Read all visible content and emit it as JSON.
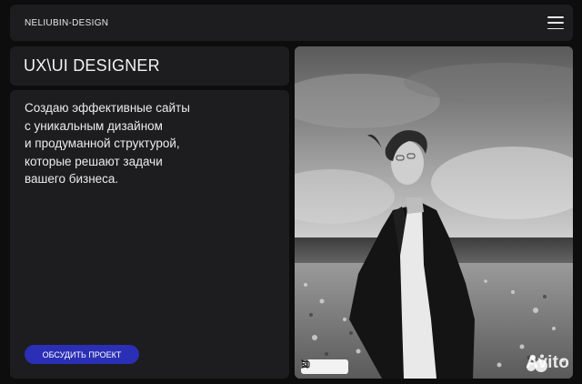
{
  "header": {
    "brand": "NELIUBIN-DESIGN",
    "menu_icon": "hamburger-menu-icon"
  },
  "hero": {
    "title": "UX\\UI DESIGNER",
    "description_lines": [
      "Создаю эффективные сайты",
      "с уникальным дизайном",
      "и продуманной структурой,",
      "которые решают задачи",
      "вашего бизнеса."
    ],
    "cta_label": "ОБСУДИТЬ ПРОЕКТ"
  },
  "photo": {
    "tools": [
      "bookmark-icon",
      "camera-search-icon",
      "more-vertical-icon"
    ],
    "watermark": "Avito"
  },
  "colors": {
    "background": "#0d0d0d",
    "card": "#1d1d1f",
    "accent": "#2b2fb5",
    "text": "#ffffff"
  }
}
